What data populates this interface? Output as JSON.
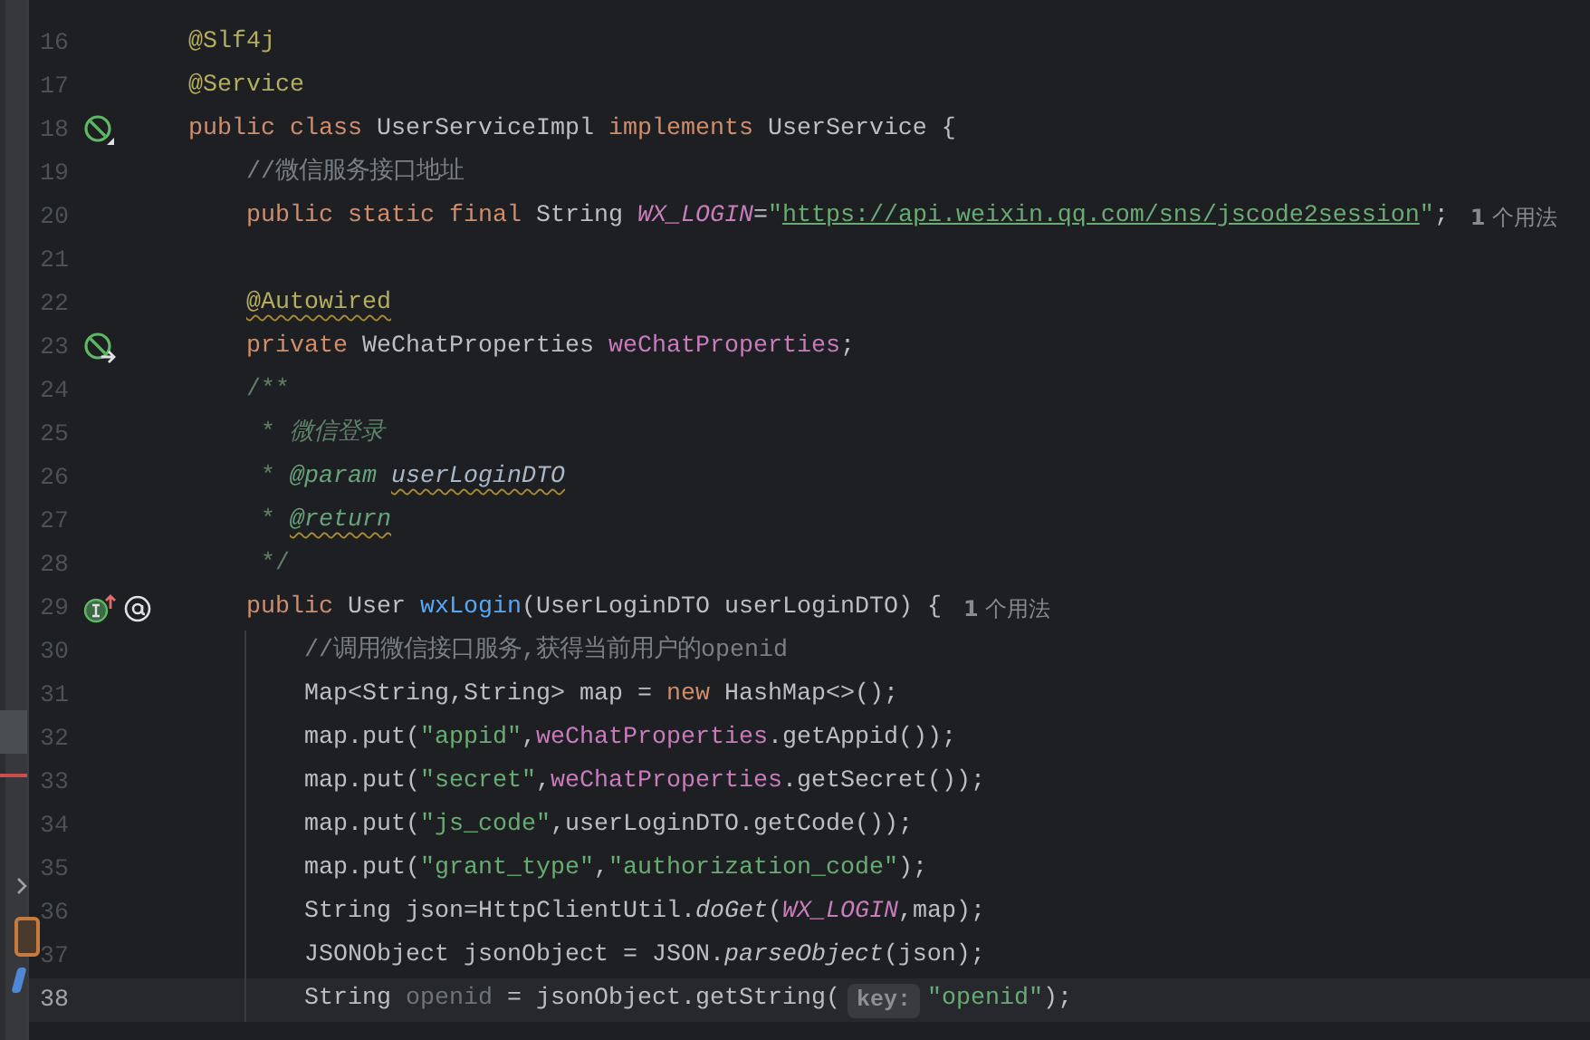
{
  "editor": {
    "lines": [
      {
        "number": "16",
        "current": false,
        "tokens": [
          {
            "kind": "ann",
            "text": "@Slf4j"
          }
        ]
      },
      {
        "number": "17",
        "current": false,
        "tokens": [
          {
            "kind": "ann",
            "text": "@Service"
          }
        ]
      },
      {
        "number": "18",
        "current": false,
        "gutter": [
          {
            "kind": "bean"
          }
        ],
        "tokens": [
          {
            "kind": "kw",
            "text": "public class "
          },
          {
            "kind": "plain",
            "text": "UserServiceImpl "
          },
          {
            "kind": "kw",
            "text": "implements "
          },
          {
            "kind": "plain",
            "text": "UserService {"
          }
        ],
        "children": [
          {
            "number": "19",
            "current": false,
            "tokens": [
              {
                "kind": "comment",
                "text": "//微信服务接口地址"
              }
            ]
          },
          {
            "number": "20",
            "current": false,
            "usage": "**1** 个用法",
            "tokens": [
              {
                "kind": "kw",
                "text": "public static final "
              },
              {
                "kind": "plain",
                "text": "String "
              },
              {
                "kind": "static",
                "text": "WX_LOGIN"
              },
              {
                "kind": "plain",
                "text": "="
              },
              {
                "kind": "str",
                "text": "\""
              },
              {
                "kind": "url",
                "text": "https://api.weixin.qq.com/sns/jscode2session"
              },
              {
                "kind": "str",
                "text": "\""
              },
              {
                "kind": "plain",
                "text": ";"
              }
            ]
          },
          {
            "number": "21",
            "current": false
          },
          {
            "number": "22",
            "current": false,
            "tokens": [
              {
                "kind": "ann-warn",
                "text": "@Autowired"
              }
            ]
          },
          {
            "number": "23",
            "current": false,
            "gutter": [
              {
                "kind": "bean-arrow"
              }
            ],
            "tokens": [
              {
                "kind": "kw",
                "text": "private "
              },
              {
                "kind": "plain",
                "text": "WeChatProperties "
              },
              {
                "kind": "field",
                "text": "weChatProperties"
              },
              {
                "kind": "plain",
                "text": ";"
              }
            ]
          },
          {
            "number": "24",
            "current": false,
            "tokens": [
              {
                "kind": "doc",
                "text": "/**"
              }
            ]
          },
          {
            "number": "25",
            "current": false,
            "tokens": [
              {
                "kind": "doc",
                "text": " * "
              },
              {
                "kind": "doc-italic",
                "text": "微信登录"
              }
            ]
          },
          {
            "number": "26",
            "current": false,
            "tokens": [
              {
                "kind": "doc",
                "text": " * "
              },
              {
                "kind": "doctag",
                "text": "@param "
              },
              {
                "kind": "docparam-warn",
                "text": "userLoginDTO"
              }
            ]
          },
          {
            "number": "27",
            "current": false,
            "tokens": [
              {
                "kind": "doc",
                "text": " * "
              },
              {
                "kind": "doctag-warn",
                "text": "@return"
              }
            ]
          },
          {
            "number": "28",
            "current": false,
            "tokens": [
              {
                "kind": "doc",
                "text": " */"
              }
            ]
          },
          {
            "number": "29",
            "current": false,
            "gutter": [
              {
                "kind": "implements"
              },
              {
                "kind": "annotation"
              }
            ],
            "usage": "**1** 个用法",
            "tokens": [
              {
                "kind": "kw",
                "text": "public "
              },
              {
                "kind": "plain",
                "text": "User "
              },
              {
                "kind": "method",
                "text": "wxLogin"
              },
              {
                "kind": "plain",
                "text": "(UserLoginDTO userLoginDTO) {"
              }
            ],
            "children": [
              {
                "number": "30",
                "current": false,
                "tokens": [
                  {
                    "kind": "comment",
                    "text": "//调用微信接口服务,获得当前用户的openid"
                  }
                ]
              },
              {
                "number": "31",
                "current": false,
                "tokens": [
                  {
                    "kind": "plain",
                    "text": "Map<String,String> map = "
                  },
                  {
                    "kind": "kw",
                    "text": "new "
                  },
                  {
                    "kind": "plain",
                    "text": "HashMap<>();"
                  }
                ]
              },
              {
                "number": "32",
                "current": false,
                "tokens": [
                  {
                    "kind": "plain",
                    "text": "map.put("
                  },
                  {
                    "kind": "str",
                    "text": "\"appid\""
                  },
                  {
                    "kind": "field",
                    "lead": ",",
                    "text": "weChatProperties"
                  },
                  {
                    "kind": "plain",
                    "text": ".getAppid());"
                  }
                ]
              },
              {
                "number": "33",
                "current": false,
                "tokens": [
                  {
                    "kind": "plain",
                    "text": "map.put("
                  },
                  {
                    "kind": "str",
                    "text": "\"secret\""
                  },
                  {
                    "kind": "field",
                    "lead": ",",
                    "text": "weChatProperties"
                  },
                  {
                    "kind": "plain",
                    "text": ".getSecret());"
                  }
                ]
              },
              {
                "number": "34",
                "current": false,
                "tokens": [
                  {
                    "kind": "plain",
                    "text": "map.put("
                  },
                  {
                    "kind": "str",
                    "text": "\"js_code\""
                  },
                  {
                    "kind": "plain",
                    "text": ",userLoginDTO.getCode());"
                  }
                ]
              },
              {
                "number": "35",
                "current": false,
                "tokens": [
                  {
                    "kind": "plain",
                    "text": "map.put("
                  },
                  {
                    "kind": "str",
                    "text": "\"grant_type\""
                  },
                  {
                    "kind": "plain",
                    "text": ","
                  },
                  {
                    "kind": "str",
                    "text": "\"authorization_code\""
                  },
                  {
                    "kind": "plain",
                    "text": ");"
                  }
                ]
              },
              {
                "number": "36",
                "current": false,
                "tokens": [
                  {
                    "kind": "plain",
                    "text": "String json=HttpClientUtil."
                  },
                  {
                    "kind": "italic",
                    "text": "doGet"
                  },
                  {
                    "kind": "plain",
                    "text": "("
                  },
                  {
                    "kind": "static",
                    "text": "WX_LOGIN"
                  },
                  {
                    "kind": "plain",
                    "text": ",map);"
                  }
                ]
              },
              {
                "number": "37",
                "current": false,
                "tokens": [
                  {
                    "kind": "plain",
                    "text": "JSONObject jsonObject = JSON."
                  },
                  {
                    "kind": "italic",
                    "text": "parseObject"
                  },
                  {
                    "kind": "plain",
                    "text": "(json);"
                  }
                ]
              },
              {
                "number": "38",
                "current": true,
                "tokens": [
                  {
                    "kind": "plain",
                    "text": "String "
                  },
                  {
                    "kind": "unused",
                    "text": "openid"
                  },
                  {
                    "kind": "plain",
                    "text": " = jsonObject.getString("
                  },
                  {
                    "kind": "hint",
                    "text": "key:"
                  },
                  {
                    "kind": "str",
                    "text": "\"openid\""
                  },
                  {
                    "kind": "plain",
                    "text": ");"
                  }
                ]
              }
            ]
          }
        ]
      }
    ]
  }
}
